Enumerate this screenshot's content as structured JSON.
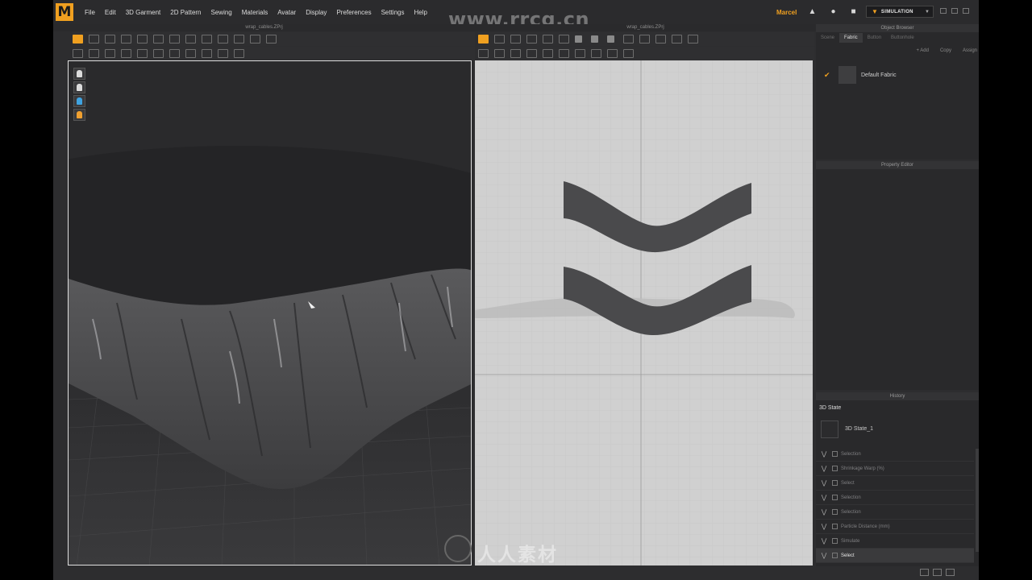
{
  "app": {
    "logo_letter": "M",
    "menus": [
      "File",
      "Edit",
      "3D Garment",
      "2D Pattern",
      "Sewing",
      "Materials",
      "Avatar",
      "Display",
      "Preferences",
      "Settings",
      "Help"
    ],
    "user": "Marcel",
    "mode_button": "SIMULATION",
    "watermark_url": "www.rrcg.cn",
    "watermark_logo_text": "人人素材"
  },
  "windows": {
    "left_title": "wrap_cables.ZPrj",
    "right_title": "wrap_cables.ZPrj"
  },
  "object_browser": {
    "title": "Object Browser",
    "tabs": [
      "Scene",
      "Fabric",
      "Button",
      "Buttonhole"
    ],
    "active_tab": "Fabric",
    "actions": [
      "+ Add",
      "Copy",
      "Assign"
    ],
    "fabrics": [
      {
        "name": "Default Fabric",
        "checked": true
      }
    ]
  },
  "property_editor": {
    "title": "Property Editor"
  },
  "history": {
    "title": "History",
    "state_title": "3D State",
    "snapshot_label": "3D State_1",
    "items": [
      {
        "label": "Selection",
        "active": false
      },
      {
        "label": "Shrinkage Warp (%)",
        "active": false
      },
      {
        "label": "Select",
        "active": false
      },
      {
        "label": "Selection",
        "active": false
      },
      {
        "label": "Selection",
        "active": false
      },
      {
        "label": "Particle Distance (mm)",
        "active": false
      },
      {
        "label": "Simulate",
        "active": false
      },
      {
        "label": "Select",
        "active": true
      }
    ]
  },
  "colors": {
    "accent": "#f0a020",
    "pattern_fill": "#4a4a4c",
    "canvas_2d": "#d0d0d0",
    "viewport_3d": "#2a2a2c"
  }
}
